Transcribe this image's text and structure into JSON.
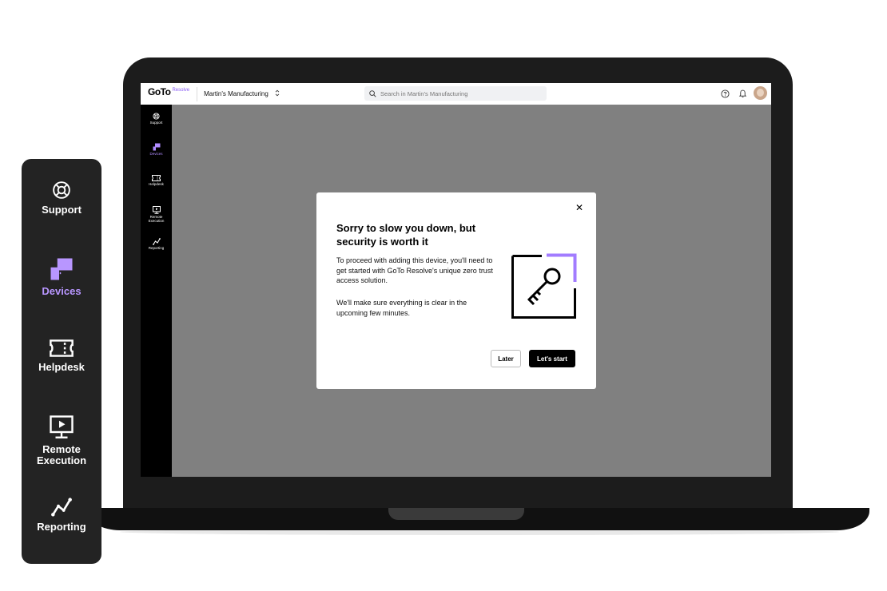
{
  "app": {
    "logo_text": "GoTo",
    "logo_sub": "Resolve",
    "account_name": "Martin's Manufacturing"
  },
  "search": {
    "placeholder": "Search in Martin's Manufacturing"
  },
  "mini_sidebar": {
    "items": [
      {
        "label": "Support",
        "icon": "lifebuoy-icon"
      },
      {
        "label": "Devices",
        "icon": "devices-icon"
      },
      {
        "label": "Helpdesk",
        "icon": "ticket-icon"
      },
      {
        "label": "Remote Execution",
        "icon": "monitor-play-icon"
      },
      {
        "label": "Reporting",
        "icon": "chart-line-icon"
      }
    ]
  },
  "big_sidebar": {
    "items": [
      {
        "label": "Support",
        "icon": "lifebuoy-icon"
      },
      {
        "label": "Devices",
        "icon": "devices-icon"
      },
      {
        "label": "Helpdesk",
        "icon": "ticket-icon"
      },
      {
        "label": "Remote Execution",
        "icon": "monitor-play-icon"
      },
      {
        "label": "Reporting",
        "icon": "chart-line-icon"
      }
    ]
  },
  "modal": {
    "title": "Sorry to slow you down, but security is worth it",
    "paragraph1": "To proceed with adding this device, you'll need to get started with GoTo Resolve's unique zero trust access solution.",
    "paragraph2": "We'll make sure everything is clear in the upcoming few minutes.",
    "close_symbol": "✕",
    "later_label": "Later",
    "start_label": "Let's start"
  },
  "colors": {
    "accent": "#8a5cf5",
    "logo_underline": "#f5e100",
    "overlay": "#808080",
    "sidebar_bg": "#232323"
  }
}
